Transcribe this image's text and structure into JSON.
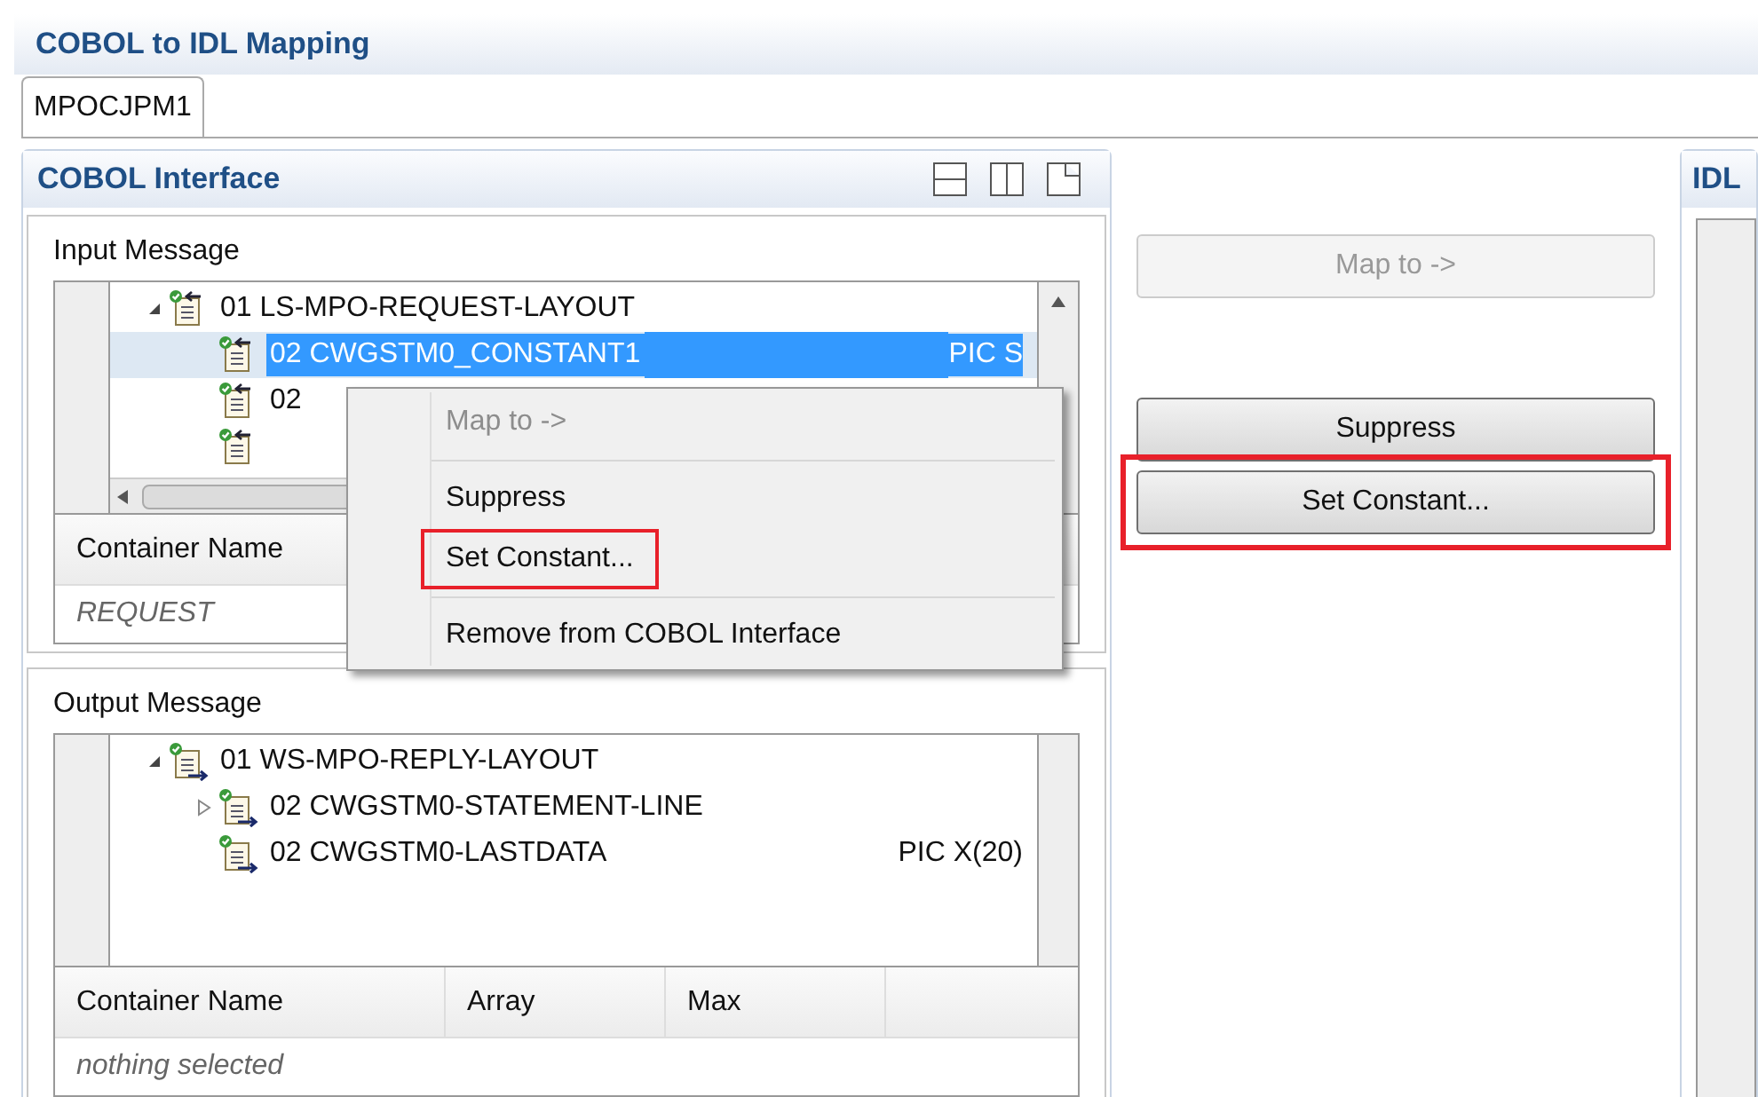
{
  "title": "COBOL to IDL Mapping",
  "tabs": [
    {
      "label": "MPOCJPM1",
      "selected": true
    }
  ],
  "cobol_interface": {
    "title": "COBOL Interface",
    "input_message": {
      "label": "Input Message",
      "tree": [
        {
          "text": "01 LS-MPO-REQUEST-LAYOUT",
          "expanded": true,
          "selected": false,
          "children": [
            {
              "text": "02 CWGSTM0_CONSTANT1",
              "pic": "PIC S",
              "selected": true
            },
            {
              "text": "02",
              "selected": false
            },
            {
              "selected": false
            }
          ]
        }
      ],
      "table": {
        "columns": [
          "Container Name"
        ],
        "rows": [
          [
            "REQUEST"
          ]
        ]
      }
    },
    "output_message": {
      "label": "Output Message",
      "tree": [
        {
          "text": "01 WS-MPO-REPLY-LAYOUT",
          "expanded": true,
          "selected": false,
          "children": [
            {
              "text": "02 CWGSTM0-STATEMENT-LINE",
              "expanded": false,
              "selected": false
            },
            {
              "text": "02 CWGSTM0-LASTDATA",
              "pic": "PIC X(20)",
              "selected": false
            }
          ]
        }
      ],
      "table": {
        "columns": [
          "Container Name",
          "Array",
          "Max"
        ],
        "rows": [
          [
            "nothing selected"
          ]
        ]
      }
    }
  },
  "actions": [
    {
      "label": "Map to ->",
      "disabled": true,
      "highlighted": false
    },
    {
      "label": "Suppress",
      "disabled": false,
      "highlighted": false
    },
    {
      "label": "Set Constant...",
      "disabled": false,
      "highlighted": true
    }
  ],
  "idl_panel": {
    "title": "IDL"
  },
  "context_menu": {
    "items": [
      {
        "kind": "item",
        "label": "Map to ->",
        "disabled": true,
        "highlighted": false
      },
      {
        "kind": "separator"
      },
      {
        "kind": "item",
        "label": "Suppress",
        "disabled": false,
        "highlighted": false
      },
      {
        "kind": "item",
        "label": "Set Constant...",
        "disabled": false,
        "highlighted": true
      },
      {
        "kind": "separator"
      },
      {
        "kind": "item",
        "label": "Remove from COBOL Interface",
        "disabled": false,
        "highlighted": false
      }
    ]
  }
}
